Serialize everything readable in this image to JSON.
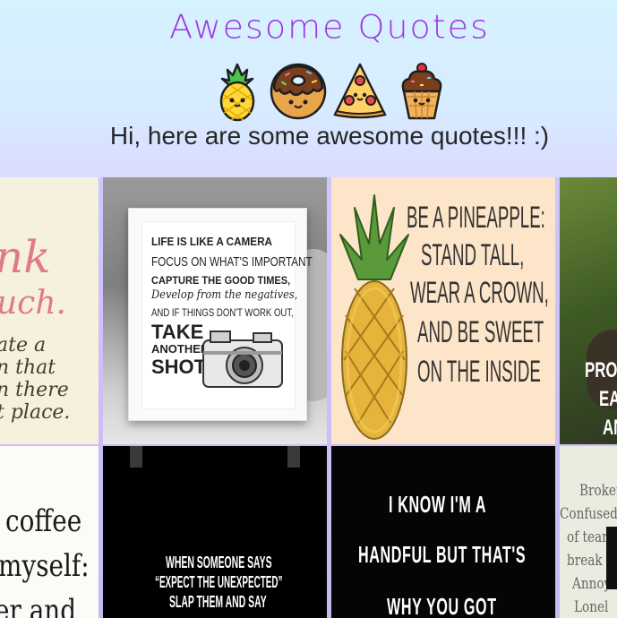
{
  "page": {
    "title": "Awesome Quotes",
    "subtitle": "Hi, here are some awesome quotes!!! :)"
  },
  "icons": [
    "pineapple-icon",
    "donut-icon",
    "pizza-slice-icon",
    "cupcake-icon"
  ],
  "tiles": [
    {
      "name": "quote-tile-drink-much",
      "fragments": [
        "nk",
        "uch.",
        "ate a",
        "n that",
        "n there",
        "t place."
      ]
    },
    {
      "name": "quote-tile-life-camera",
      "lines": [
        "LIFE IS LIKE A CAMERA",
        "FOCUS ON WHAT'S IMPORTANT",
        "CAPTURE THE GOOD TIMES,",
        "Develop from the negatives,",
        "AND IF THINGS DON'T WORK OUT,",
        "TAKE",
        "ANOTHER",
        "SHOT"
      ]
    },
    {
      "name": "quote-tile-pineapple",
      "lines": [
        "BE A PINEAPPLE:",
        "STAND TALL,",
        "WEAR A CROWN,",
        "AND BE SWEET",
        "ON THE INSIDE"
      ]
    },
    {
      "name": "quote-tile-procrastination",
      "fragments": [
        "PRO",
        "EAT",
        "AN"
      ]
    },
    {
      "name": "quote-tile-coffee",
      "fragments": [
        "coffee",
        "myself:",
        "er and"
      ]
    },
    {
      "name": "quote-tile-expect-unexpected",
      "lines": [
        "WHEN SOMEONE SAYS",
        "“EXPECT THE UNEXPECTED”",
        "SLAP THEM AND SAY"
      ]
    },
    {
      "name": "quote-tile-handful",
      "lines": [
        "I KNOW I'M A",
        "HANDFUL BUT THAT'S",
        "WHY YOU GOT"
      ]
    },
    {
      "name": "quote-tile-broken",
      "fragments": [
        "Broker",
        "Confused.",
        "of tears,",
        "break do",
        "Annoy",
        "Lonel"
      ]
    }
  ]
}
